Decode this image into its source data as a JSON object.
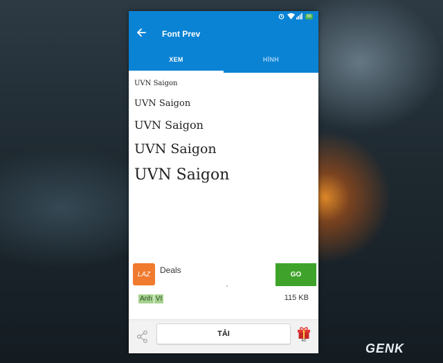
{
  "app": {
    "title": "Font Prev",
    "back_icon": "arrow-left-icon"
  },
  "status_bar": {
    "icons": [
      "alarm-icon",
      "wifi-icon",
      "signal-icon",
      "battery-icon"
    ],
    "battery_text": "88"
  },
  "tabs": [
    {
      "label": "XEM",
      "active": true
    },
    {
      "label": "HÌNH",
      "active": false
    }
  ],
  "preview": {
    "lines": [
      "UVN Saigon",
      "UVN Saigon",
      "UVN Saigon",
      "UVN Saigon",
      "UVN Saigon"
    ]
  },
  "ad": {
    "logo_text": "LAZ",
    "title": "Deals",
    "button_label": "GO",
    "button_color": "#3fa32b",
    "logo_color": "#f07a2e"
  },
  "meta": {
    "tags": [
      "Anh",
      "VI"
    ],
    "file_size": "115 KB"
  },
  "bottom_bar": {
    "share_icon": "share-icon",
    "download_label": "TẢI",
    "gift_icon": "gift-icon",
    "gift_label": "AD"
  },
  "watermark": "GENK",
  "colors": {
    "primary": "#0a83d4",
    "tab_indicator": "#ffffff",
    "tag_bg": "#a6d18f"
  }
}
